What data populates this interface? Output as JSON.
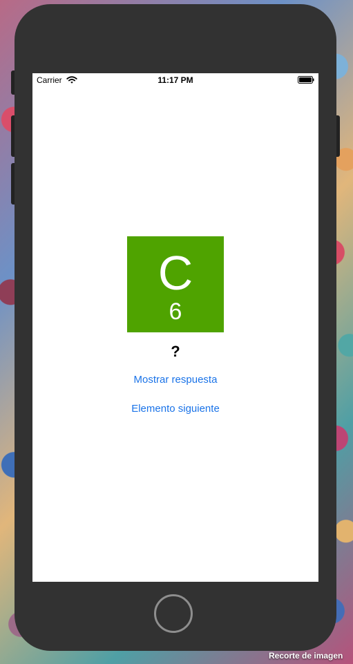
{
  "status_bar": {
    "carrier": "Carrier",
    "time": "11:17 PM",
    "wifi_icon": "wifi-icon",
    "battery_icon": "battery-icon"
  },
  "element_card": {
    "symbol": "C",
    "atomic_number": "6",
    "background_color": "#4fa300"
  },
  "quiz": {
    "answer_placeholder": "?",
    "show_answer_label": "Mostrar respuesta",
    "next_element_label": "Elemento siguiente",
    "link_color": "#1a73e8"
  },
  "device": {
    "home_button_icon": "home-button"
  },
  "overlay": {
    "caption": "Recorte de imagen"
  }
}
